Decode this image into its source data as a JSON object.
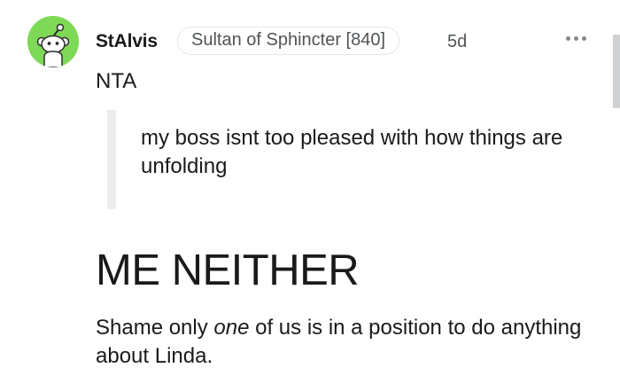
{
  "comment": {
    "author": "StAlvis",
    "flair": "Sultan of Sphincter [840]",
    "age": "5d",
    "body": "NTA",
    "quote": "my boss isnt too pleased with how things are unfolding",
    "heading": "ME NEITHER",
    "paragraph": {
      "before": "Shame only ",
      "emphasis": "one",
      "after": " of us is in a position to do anything about Linda."
    }
  },
  "colors": {
    "avatar_bg": "#7ed957",
    "text": "#1a1a1b",
    "meta": "#4f5457",
    "quote_bar": "#ececec"
  },
  "icons": {
    "avatar": "snoo-avatar-icon",
    "more": "more-options-icon"
  }
}
